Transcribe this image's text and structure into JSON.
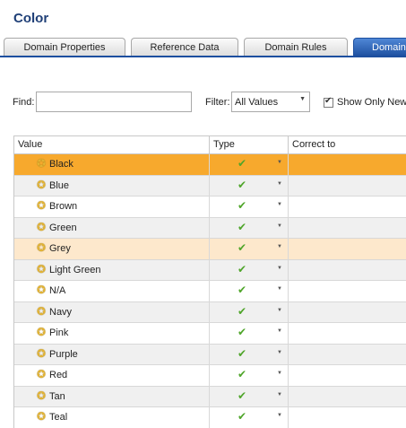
{
  "window": {
    "title": "Color"
  },
  "tabs": [
    {
      "label": "Domain Properties"
    },
    {
      "label": "Reference Data"
    },
    {
      "label": "Domain Rules"
    },
    {
      "label": "Domain"
    }
  ],
  "toolbar": {
    "find_label": "Find:",
    "find_value": "",
    "filter_label": "Filter:",
    "filter_value": "All Values",
    "show_only_new_label": "Show Only New",
    "show_only_new_checked": true
  },
  "grid": {
    "columns": [
      "Value",
      "Type",
      "Correct to"
    ],
    "rows": [
      {
        "value": "Black",
        "state": "selected"
      },
      {
        "value": "Blue"
      },
      {
        "value": "Brown"
      },
      {
        "value": "Green"
      },
      {
        "value": "Grey",
        "state": "highlighted"
      },
      {
        "value": "Light Green"
      },
      {
        "value": "N/A"
      },
      {
        "value": "Navy"
      },
      {
        "value": "Pink"
      },
      {
        "value": "Purple"
      },
      {
        "value": "Red"
      },
      {
        "value": "Tan"
      },
      {
        "value": "Teal"
      }
    ]
  },
  "colors": {
    "title": "#1f3f77",
    "selected_row": "#f7a92d",
    "highlighted_row": "#fde8cc",
    "active_tab": "#1d4f9f",
    "check": "#4fa52a"
  },
  "icons": {
    "value_icon": "star-icon",
    "type_icon": "checkmark-icon",
    "type_dropdown": "chevron-down-icon"
  }
}
